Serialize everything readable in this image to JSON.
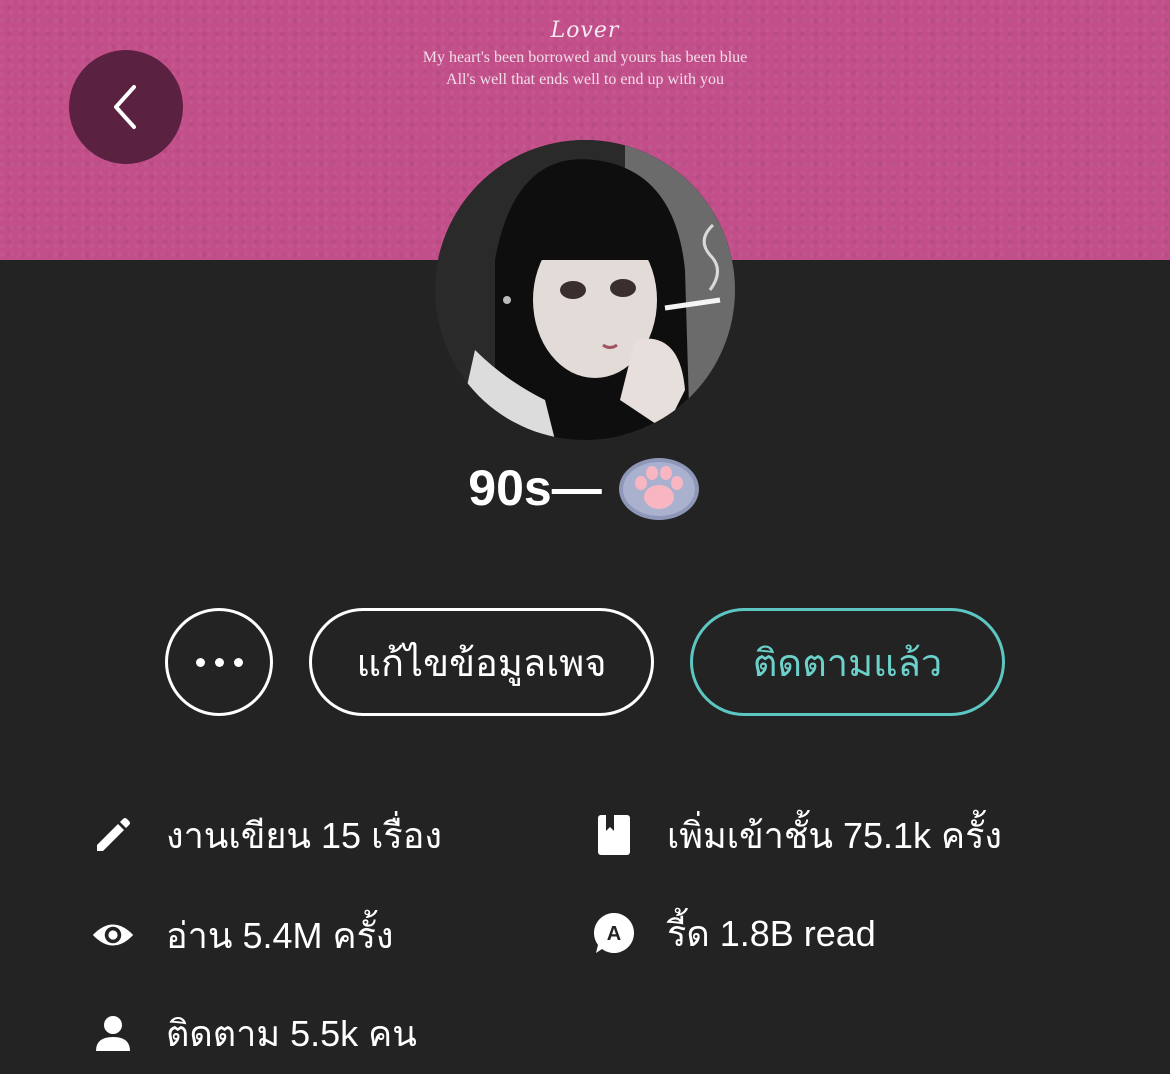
{
  "banner": {
    "title": "Lover",
    "line1": "My heart's been borrowed and yours has been blue",
    "line2": "All's well that ends well to end up with you",
    "color": "#c24f8a"
  },
  "navigation": {
    "back_icon": "chevron-left-icon"
  },
  "profile": {
    "name": "90s—",
    "badge_icon": "paw-icon"
  },
  "actions": {
    "more_icon": "more-dots-icon",
    "edit_label": "แก้ไขข้อมูลเพจ",
    "follow_label": "ติดตามแล้ว",
    "follow_color": "#5ec6c1"
  },
  "stats": {
    "works": {
      "icon": "pencil-icon",
      "label": "งานเขียน 15 เรื่อง"
    },
    "reads": {
      "icon": "eye-icon",
      "label": "อ่าน 5.4M ครั้ง"
    },
    "followers": {
      "icon": "person-icon",
      "label": "ติดตาม 5.5k คน"
    },
    "bookshelf": {
      "icon": "book-icon",
      "label": "เพิ่มเข้าชั้น 75.1k ครั้ง"
    },
    "read_count": {
      "icon": "read-bubble-icon",
      "label": "รี้ด 1.8B read"
    }
  }
}
